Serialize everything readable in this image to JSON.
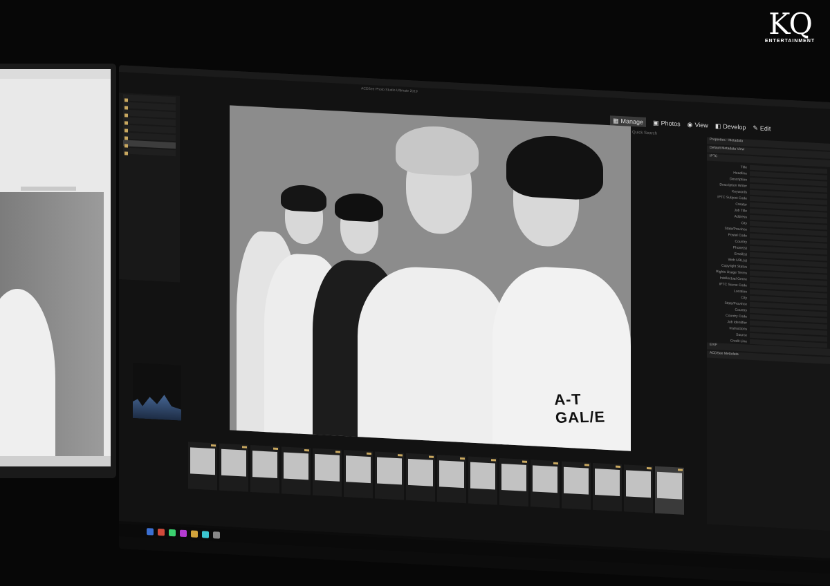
{
  "logo": {
    "mark": "KQ",
    "sub": "ENTERTAINMENT"
  },
  "app": {
    "title": "ACDSee Photo Studio Ultimate 2019",
    "modes": [
      {
        "label": "Manage",
        "icon": "grid-icon",
        "active": true
      },
      {
        "label": "Photos",
        "icon": "photos-icon",
        "active": false
      },
      {
        "label": "View",
        "icon": "eye-icon",
        "active": false
      },
      {
        "label": "Develop",
        "icon": "develop-icon",
        "active": false
      },
      {
        "label": "Edit",
        "icon": "edit-icon",
        "active": false
      }
    ],
    "search_placeholder": "Quick Search",
    "panel_title": "Properties - Metadata",
    "metadata_view": "Default Metadata View",
    "sections": {
      "iptc": "IPTC",
      "exif": "EXIF",
      "acdsee": "ACDSee Metadata"
    },
    "iptc_fields": [
      "Title",
      "Headline",
      "Description",
      "Description Writer",
      "Keywords",
      "IPTC Subject Code",
      "Creator",
      "Job Title",
      "Address",
      "City",
      "State/Province",
      "Postal Code",
      "Country",
      "Phone(s)",
      "Email(s)",
      "Web URL(s)",
      "Copyright Status",
      "Rights Usage Terms",
      "Intellectual Genre",
      "IPTC Scene Code",
      "Location",
      "City",
      "State/Province",
      "Country",
      "Country Code",
      "Job Identifier",
      "Instructions",
      "Source",
      "Credit Line"
    ],
    "jacket_text": "A-T GAL/E",
    "thumbnails_count": 16
  },
  "colors": {
    "accent": "#c9a860",
    "background": "#070707"
  }
}
